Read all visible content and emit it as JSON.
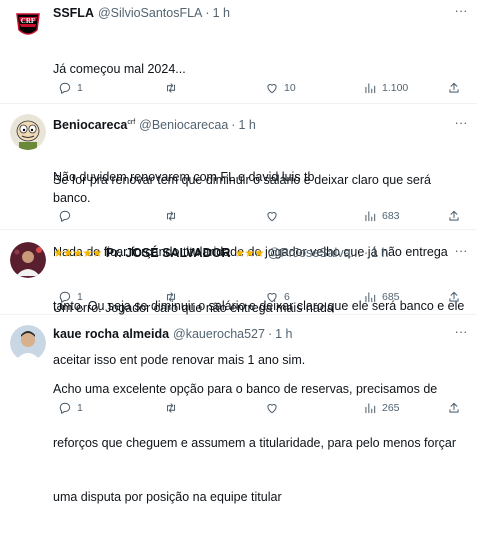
{
  "tweets": [
    {
      "name": "SSFLA",
      "handle": "@SilvioSantosFLA",
      "time": "1 h",
      "lines": [
        "Já começou mal 2024...",
        "",
        "Não duvidem renovarem com FL e david luis tb"
      ],
      "replies": "1",
      "retweets": "",
      "likes": "10",
      "views": "1.100"
    },
    {
      "name": "Beniocareca",
      "name_sup": "crf",
      "handle": "@Beniocarecaa",
      "time": "1 h",
      "lines": [
        "Se for pra renovar tem que diminuir o salário e deixar claro que será banco.",
        "Nada de ficar forçando titularidade de jogador velho que já não entrega",
        "tanto. Ou seja se diminuir o salário e deixar claro que ele será banco e ele",
        "aceitar isso ent pode renovar mais 1 ano sim."
      ],
      "replies": "",
      "retweets": "",
      "likes": "",
      "views": "683"
    },
    {
      "name_prefix": "★★★★★",
      "name": "Pr. JOSÉ SALVADOR",
      "name_suffix": "★★★",
      "handle": "@PrJoseSalva...",
      "time": "1 h",
      "lines": [
        "Um erro. Jogador caro que não entrega mais nada"
      ],
      "replies": "1",
      "retweets": "",
      "likes": "6",
      "views": "685"
    },
    {
      "name": "kaue rocha almeida",
      "handle": "@kauerocha527",
      "time": "1 h",
      "lines": [
        "Acho uma excelente opção para o banco de reservas, precisamos de",
        "reforços que cheguem e assumem a titularidade, para pelo menos forçar",
        "uma disputa por posição na equipe titular"
      ],
      "replies": "1",
      "retweets": "",
      "likes": "",
      "views": "265"
    }
  ],
  "more_symbol": "···",
  "dot_symbol": "·",
  "colors": {
    "text": "#0f1419",
    "muted": "#536471",
    "divider": "#eff3f4",
    "star": "#f4b400",
    "flamengo_red": "#c8102e"
  }
}
